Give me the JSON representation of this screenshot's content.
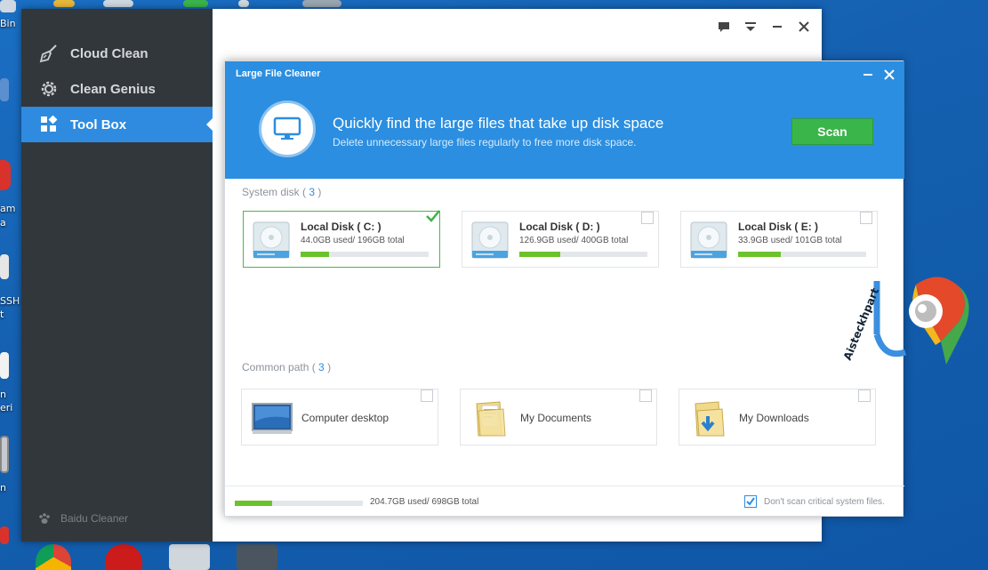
{
  "desktop": {
    "labels": [
      "Bin",
      "am",
      "a",
      "SSH",
      "t",
      "n",
      "eri",
      "n"
    ]
  },
  "sidebar": {
    "items": [
      {
        "label": "Cloud Clean",
        "icon": "broom-icon"
      },
      {
        "label": "Clean Genius",
        "icon": "gear-icon"
      },
      {
        "label": "Tool Box",
        "icon": "grid-icon"
      }
    ],
    "brand": "Baidu Cleaner"
  },
  "dialog": {
    "title": "Large File Cleaner",
    "hero_title": "Quickly find the large files that take up disk space",
    "hero_subtitle": "Delete unnecessary large files regularly to free more disk space.",
    "scan_label": "Scan",
    "system_disk_label": "System disk",
    "system_disk_count": "3",
    "disks": [
      {
        "name": "Local Disk ( C: )",
        "stat": "44.0GB  used/ 196GB  total",
        "used_fraction": 0.22,
        "selected": true
      },
      {
        "name": "Local Disk ( D: )",
        "stat": "126.9GB  used/ 400GB  total",
        "used_fraction": 0.32,
        "selected": false
      },
      {
        "name": "Local Disk ( E: )",
        "stat": "33.9GB  used/ 101GB  total",
        "used_fraction": 0.33,
        "selected": false
      }
    ],
    "common_path_label": "Common path",
    "common_path_count": "3",
    "paths": [
      {
        "name": "Computer desktop",
        "icon": "monitor-icon"
      },
      {
        "name": "My Documents",
        "icon": "documents-folder-icon"
      },
      {
        "name": "My Downloads",
        "icon": "downloads-folder-icon"
      }
    ],
    "total_stat": "204.7GB  used/ 698GB  total",
    "total_used_fraction": 0.29,
    "footer_note": "Don't scan critical system files.",
    "footer_checked": true
  },
  "watermark_text": "Aisteckhpart",
  "colors": {
    "accent": "#2b8ee0",
    "sidebar": "#32373b",
    "scan_green": "#3ab54a",
    "bar_green": "#6cc22b"
  }
}
